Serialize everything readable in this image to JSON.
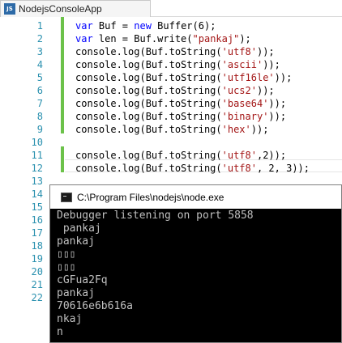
{
  "tab": {
    "icon": "js-file-icon",
    "icon_text": "JS",
    "title": "NodejsConsoleApp"
  },
  "editor": {
    "line_numbers": [
      "1",
      "2",
      "3",
      "4",
      "5",
      "6",
      "7",
      "8",
      "9",
      "10",
      "11",
      "12",
      "13",
      "14",
      "15",
      "16",
      "17",
      "18",
      "19",
      "20",
      "21",
      "22"
    ],
    "lines": [
      [
        {
          "t": "var",
          "k": "kw"
        },
        {
          "t": " Buf = "
        },
        {
          "t": "new",
          "k": "kw"
        },
        {
          "t": " Buffer(6);"
        }
      ],
      [
        {
          "t": "var",
          "k": "kw"
        },
        {
          "t": " len = Buf.write("
        },
        {
          "t": "\"pankaj\"",
          "k": "str"
        },
        {
          "t": ");"
        }
      ],
      [
        {
          "t": "console.log(Buf.toString("
        },
        {
          "t": "'utf8'",
          "k": "str"
        },
        {
          "t": "));"
        }
      ],
      [
        {
          "t": "console.log(Buf.toString("
        },
        {
          "t": "'ascii'",
          "k": "str"
        },
        {
          "t": "));"
        }
      ],
      [
        {
          "t": "console.log(Buf.toString("
        },
        {
          "t": "'utf16le'",
          "k": "str"
        },
        {
          "t": "));"
        }
      ],
      [
        {
          "t": "console.log(Buf.toString("
        },
        {
          "t": "'ucs2'",
          "k": "str"
        },
        {
          "t": "));"
        }
      ],
      [
        {
          "t": "console.log(Buf.toString("
        },
        {
          "t": "'base64'",
          "k": "str"
        },
        {
          "t": "));"
        }
      ],
      [
        {
          "t": "console.log(Buf.toString("
        },
        {
          "t": "'binary'",
          "k": "str"
        },
        {
          "t": "));"
        }
      ],
      [
        {
          "t": "console.log(Buf.toString("
        },
        {
          "t": "'hex'",
          "k": "str"
        },
        {
          "t": "));"
        }
      ],
      [],
      [
        {
          "t": "console.log(Buf.toString("
        },
        {
          "t": "'utf8'",
          "k": "str"
        },
        {
          "t": ",2));"
        }
      ],
      [
        {
          "t": "console.log(Buf.toString("
        },
        {
          "t": "'utf8'",
          "k": "str"
        },
        {
          "t": ", 2, 3));"
        }
      ]
    ]
  },
  "console": {
    "icon": "console-window-icon",
    "title": "C:\\Program Files\\nodejs\\node.exe",
    "output": [
      "Debugger listening on port 5858",
      " pankaj",
      "pankaj",
      "▯▯▯",
      "▯▯▯",
      "cGFua2Fq",
      "pankaj",
      "70616e6b616a",
      "nkaj",
      "n"
    ]
  },
  "colors": {
    "keyword": "#0000ff",
    "string": "#a31515",
    "line_number": "#2b91af",
    "change_bar": "#6cc24a",
    "console_bg": "#000000",
    "console_fg": "#c0c0c0"
  }
}
